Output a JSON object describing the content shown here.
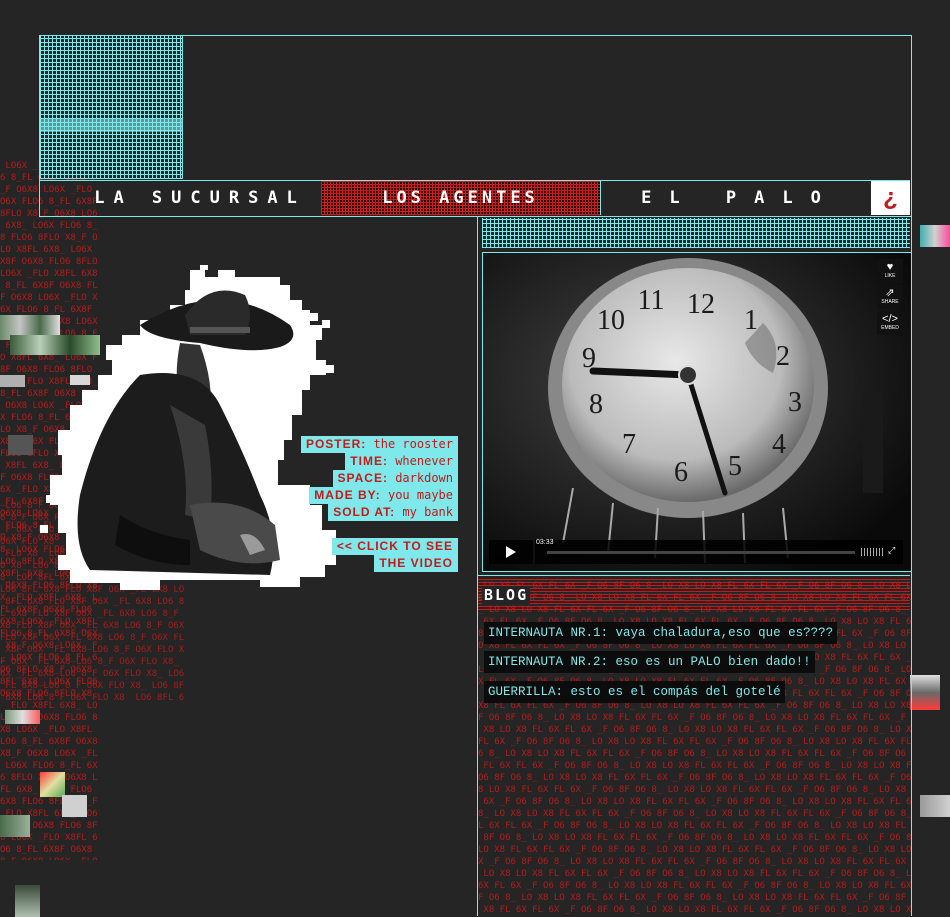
{
  "nav": {
    "item1": "LA SUCURSAL",
    "item2": "LOS AGENTES",
    "item3": "EL PALO",
    "mark": "¿"
  },
  "texture_text": "FLO6X8_FLO6X8",
  "poster": {
    "rows": [
      {
        "label": "POSTER:",
        "value": "the rooster"
      },
      {
        "label": "TIME:",
        "value": "whenever"
      },
      {
        "label": "SPACE:",
        "value": "darkdown"
      },
      {
        "label": "MADE BY:",
        "value": "you maybe"
      },
      {
        "label": "SOLD AT:",
        "value": "my bank"
      }
    ],
    "cta_line1": "<< CLICK TO SEE",
    "cta_line2": "THE VIDEO"
  },
  "video": {
    "like_label": "LIKE",
    "share_label": "SHARE",
    "embed_label": "EMBED",
    "time": "03:33"
  },
  "blog": {
    "title": "BLOG",
    "comments": [
      {
        "author": "INTERNAUTA NR.1:",
        "text": "vaya chaladura,eso que es????"
      },
      {
        "author": "INTERNAUTA NR.2:",
        "text": "eso es un PALO bien dado!!"
      },
      {
        "author": "GUERRILLA:",
        "text": "esto es el compás del gotelé"
      }
    ]
  },
  "colors": {
    "background": "#252525",
    "cyan": "#7ee8ea",
    "red": "#c41a1a"
  }
}
